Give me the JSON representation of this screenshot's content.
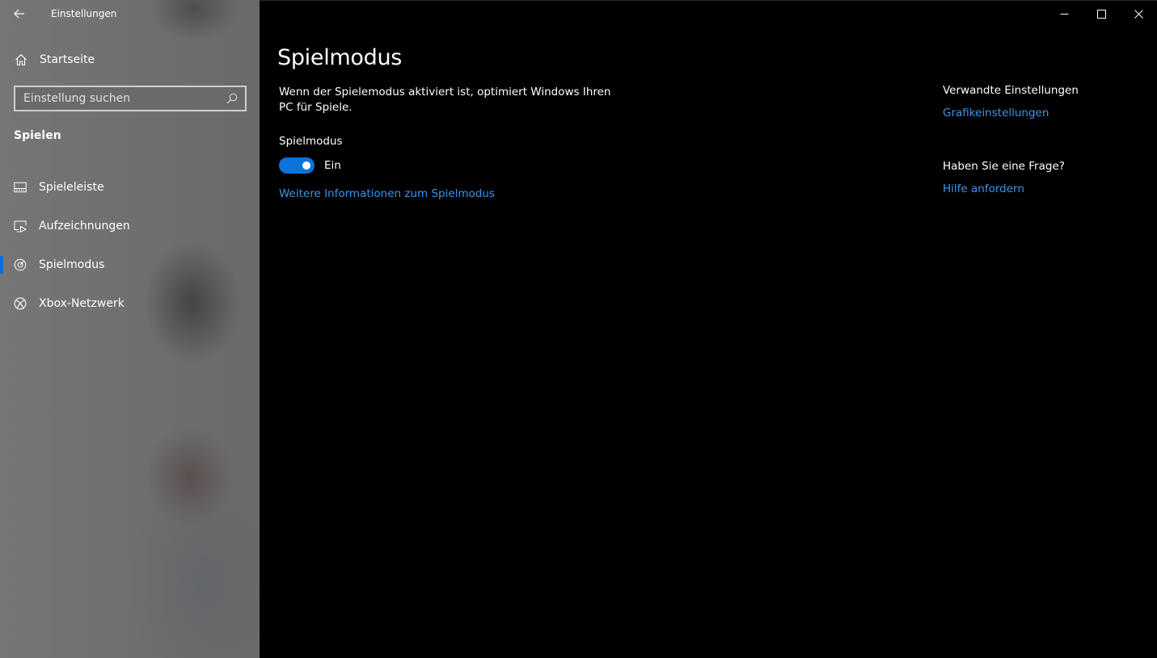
{
  "window": {
    "app_title": "Einstellungen"
  },
  "sidebar": {
    "home_label": "Startseite",
    "search_placeholder": "Einstellung suchen",
    "section_title": "Spielen",
    "items": [
      {
        "label": "Spieleleiste",
        "icon": "game-bar-icon",
        "selected": false
      },
      {
        "label": "Aufzeichnungen",
        "icon": "captures-icon",
        "selected": false
      },
      {
        "label": "Spielmodus",
        "icon": "game-mode-icon",
        "selected": true
      },
      {
        "label": "Xbox-Netzwerk",
        "icon": "xbox-icon",
        "selected": false
      }
    ]
  },
  "main": {
    "title": "Spielmodus",
    "description": "Wenn der Spielemodus aktiviert ist, optimiert Windows Ihren PC für Spiele.",
    "setting_label": "Spielmodus",
    "toggle_on": true,
    "toggle_state": "Ein",
    "more_info_link": "Weitere Informationen zum Spielmodus",
    "related_heading": "Verwandte Einstellungen",
    "related_link": "Grafikeinstellungen",
    "question_heading": "Haben Sie eine Frage?",
    "question_link": "Hilfe anfordern"
  },
  "colors": {
    "accent": "#0a74da",
    "link": "#3d94ec",
    "background": "#000000",
    "sidebar": "#727272"
  }
}
